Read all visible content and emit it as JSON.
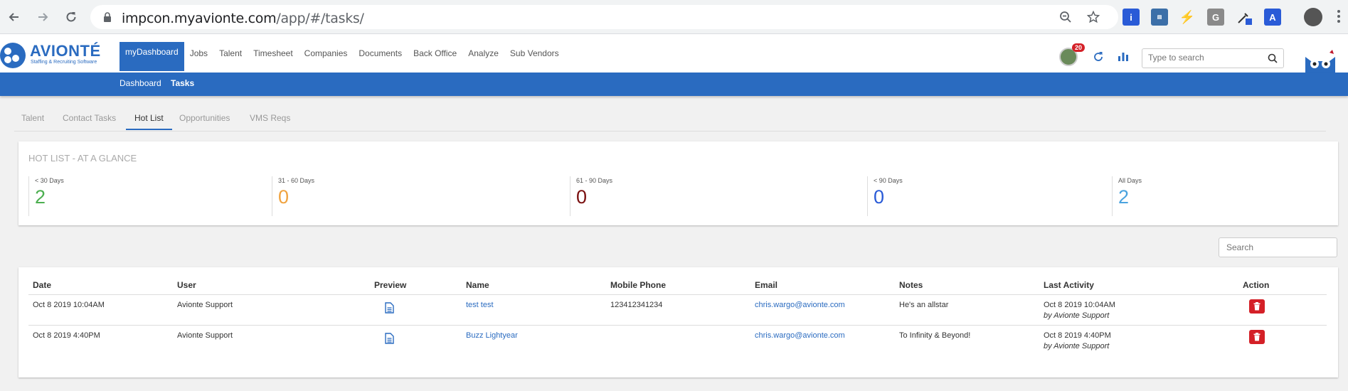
{
  "browser": {
    "url_host": "impcon.myavionte.com",
    "url_path": "/app/#/tasks/"
  },
  "logo": {
    "name": "AVIONTÉ",
    "tagline": "Staffing & Recruiting Software"
  },
  "main_nav": [
    "myDashboard",
    "Jobs",
    "Talent",
    "Timesheet",
    "Companies",
    "Documents",
    "Back Office",
    "Analyze",
    "Sub Vendors"
  ],
  "header": {
    "notification_count": "20",
    "search_placeholder": "Type to search"
  },
  "sub_nav": [
    "Dashboard",
    "Tasks"
  ],
  "tabs": [
    "Talent",
    "Contact Tasks",
    "Hot List",
    "Opportunities",
    "VMS Reqs"
  ],
  "glance": {
    "title": "HOT LIST - AT A GLANCE",
    "stats": [
      {
        "label": "< 30 Days",
        "value": "2",
        "color": "#4caf50"
      },
      {
        "label": "31 - 60 Days",
        "value": "0",
        "color": "#f0a340"
      },
      {
        "label": "61 - 90 Days",
        "value": "0",
        "color": "#7a1010"
      },
      {
        "label": "< 90 Days",
        "value": "0",
        "color": "#2a5bd7"
      },
      {
        "label": "All Days",
        "value": "2",
        "color": "#4aa3df"
      }
    ]
  },
  "table": {
    "search_placeholder": "Search",
    "headers": [
      "Date",
      "User",
      "Preview",
      "Name",
      "Mobile Phone",
      "Email",
      "Notes",
      "Last Activity",
      "Action"
    ],
    "rows": [
      {
        "date": "Oct 8 2019 10:04AM",
        "user": "Avionte Support",
        "name": "test test",
        "phone": "123412341234",
        "email": "chris.wargo@avionte.com",
        "notes": "He's an allstar",
        "last_activity": "Oct 8 2019 10:04AM",
        "by": "by Avionte Support"
      },
      {
        "date": "Oct 8 2019 4:40PM",
        "user": "Avionte Support",
        "name": "Buzz Lightyear",
        "phone": "",
        "email": "chris.wargo@avionte.com",
        "notes": "To Infinity & Beyond!",
        "last_activity": "Oct 8 2019 4:40PM",
        "by": "by Avionte Support"
      }
    ]
  },
  "colors": {
    "brand": "#2a6bc0",
    "delete": "#d42027"
  }
}
